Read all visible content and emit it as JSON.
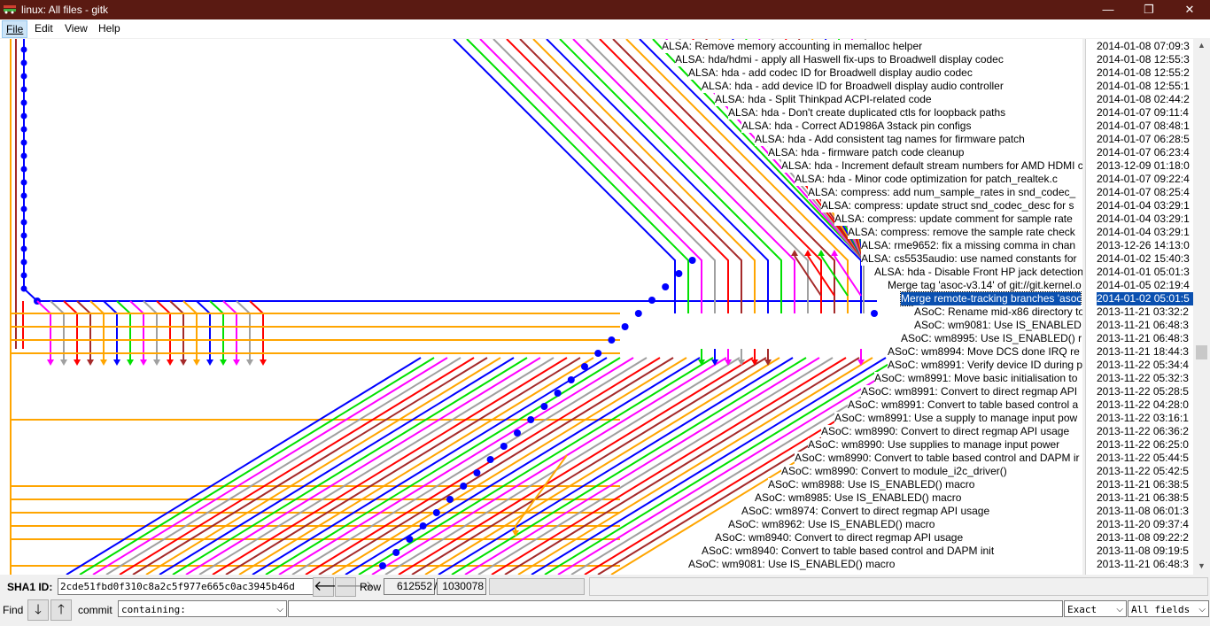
{
  "window": {
    "title": "linux: All files - gitk",
    "minimize_glyph": "—",
    "maximize_glyph": "❐",
    "close_glyph": "✕"
  },
  "menu": [
    {
      "label": "File"
    },
    {
      "label": "Edit"
    },
    {
      "label": "View"
    },
    {
      "label": "Help"
    }
  ],
  "commits": [
    {
      "subject": "ALSA: Remove memory accounting in memalloc helper",
      "date": "2014-01-08 07:09:3",
      "indent": 747
    },
    {
      "subject": "ALSA: hda/hdmi - apply all Haswell fix-ups to Broadwell display codec",
      "date": "2014-01-08 12:55:3",
      "indent": 762
    },
    {
      "subject": "ALSA: hda - add codec ID for Broadwell display audio codec",
      "date": "2014-01-08 12:55:2",
      "indent": 777
    },
    {
      "subject": "ALSA: hda - add device ID for Broadwell display audio controller",
      "date": "2014-01-08 12:55:1",
      "indent": 792
    },
    {
      "subject": "ALSA: hda - Split Thinkpad ACPI-related code",
      "date": "2014-01-08 02:44:2",
      "indent": 807
    },
    {
      "subject": "ALSA: hda - Don't create duplicated ctls for loopback paths",
      "date": "2014-01-07 09:11:4",
      "indent": 822
    },
    {
      "subject": "ALSA: hda - Correct AD1986A 3stack pin configs",
      "date": "2014-01-07 08:48:1",
      "indent": 837
    },
    {
      "subject": "ALSA: hda - Add consistent tag names for firmware patch",
      "date": "2014-01-07 06:28:5",
      "indent": 852
    },
    {
      "subject": "ALSA: hda - firmware patch code cleanup",
      "date": "2014-01-07 06:23:4",
      "indent": 867
    },
    {
      "subject": "ALSA: hda - Increment default stream numbers for AMD HDMI c",
      "date": "2013-12-09 01:18:0",
      "indent": 882
    },
    {
      "subject": "ALSA: hda - Minor code optimization for patch_realtek.c",
      "date": "2014-01-07 09:22:4",
      "indent": 897
    },
    {
      "subject": "ALSA: compress: add num_sample_rates in snd_codec_",
      "date": "2014-01-07 08:25:4",
      "indent": 912
    },
    {
      "subject": "ALSA: compress: update struct snd_codec_desc for s",
      "date": "2014-01-04 03:29:1",
      "indent": 927
    },
    {
      "subject": "ALSA: compress: update comment for sample rate",
      "date": "2014-01-04 03:29:1",
      "indent": 942
    },
    {
      "subject": "ALSA: compress: remove the sample rate check",
      "date": "2014-01-04 03:29:1",
      "indent": 957
    },
    {
      "subject": "ALSA: rme9652: fix a missing comma in chan",
      "date": "2013-12-26 14:13:0",
      "indent": 972
    },
    {
      "subject": "ALSA: cs5535audio: use named constants for",
      "date": "2014-01-02 15:40:3",
      "indent": 972
    },
    {
      "subject": "ALSA: hda - Disable Front HP jack detection",
      "date": "2014-01-01 05:01:3",
      "indent": 987
    },
    {
      "subject": "Merge tag 'asoc-v3.14' of git://git.kernel.o",
      "date": "2014-01-05 02:19:4",
      "indent": 1002
    },
    {
      "subject": "Merge remote-tracking branches 'asoc",
      "date": "2014-01-02 05:01:5",
      "indent": 1017,
      "selected": true
    },
    {
      "subject": "ASoC: Rename mid-x86 directory to",
      "date": "2013-11-21 03:32:2",
      "indent": 1032
    },
    {
      "subject": "ASoC: wm9081: Use IS_ENABLED",
      "date": "2013-11-21 06:48:3",
      "indent": 1032
    },
    {
      "subject": "ASoC: wm8995: Use IS_ENABLED() r",
      "date": "2013-11-21 06:48:3",
      "indent": 1017
    },
    {
      "subject": "ASoC: wm8994: Move DCS done IRQ re",
      "date": "2013-11-21 18:44:3",
      "indent": 1002
    },
    {
      "subject": "ASoC: wm8991: Verify device ID during p",
      "date": "2013-11-22 05:34:4",
      "indent": 1002
    },
    {
      "subject": "ASoC: wm8991: Move basic initialisation to",
      "date": "2013-11-22 05:32:3",
      "indent": 987
    },
    {
      "subject": "ASoC: wm8991: Convert to direct regmap API",
      "date": "2013-11-22 05:28:5",
      "indent": 972
    },
    {
      "subject": "ASoC: wm8991: Convert to table based control a",
      "date": "2013-11-22 04:28:0",
      "indent": 957
    },
    {
      "subject": "ASoC: wm8991: Use a supply to manage input pow",
      "date": "2013-11-22 03:16:1",
      "indent": 942
    },
    {
      "subject": "ASoC: wm8990: Convert to direct regmap API usage",
      "date": "2013-11-22 06:36:2",
      "indent": 927
    },
    {
      "subject": "ASoC: wm8990: Use supplies to manage input power",
      "date": "2013-11-22 06:25:0",
      "indent": 912
    },
    {
      "subject": "ASoC: wm8990: Convert to table based control and DAPM ir",
      "date": "2013-11-22 05:44:5",
      "indent": 897
    },
    {
      "subject": "ASoC: wm8990: Convert to module_i2c_driver()",
      "date": "2013-11-22 05:42:5",
      "indent": 882
    },
    {
      "subject": "ASoC: wm8988: Use IS_ENABLED() macro",
      "date": "2013-11-21 06:38:5",
      "indent": 867
    },
    {
      "subject": "ASoC: wm8985: Use IS_ENABLED() macro",
      "date": "2013-11-21 06:38:5",
      "indent": 852
    },
    {
      "subject": "ASoC: wm8974: Convert to direct regmap API usage",
      "date": "2013-11-08 06:01:3",
      "indent": 837
    },
    {
      "subject": "ASoC: wm8962: Use IS_ENABLED() macro",
      "date": "2013-11-20 09:37:4",
      "indent": 822
    },
    {
      "subject": "ASoC: wm8940: Convert to direct regmap API usage",
      "date": "2013-11-08 09:22:2",
      "indent": 807
    },
    {
      "subject": "ASoC: wm8940: Convert to table based control and DAPM init",
      "date": "2013-11-08 09:19:5",
      "indent": 792
    },
    {
      "subject": "ASoC: wm9081: Use IS_ENABLED() macro",
      "date": "2013-11-21 06:48:3",
      "indent": 777
    }
  ],
  "sha_bar": {
    "label": "SHA1 ID:",
    "value": "2cde51fbd0f310c8a2c5f977e665c0ac3945b46d",
    "back_glyph": "🡐",
    "forward_glyph": "🡒",
    "row_label": "Row",
    "row_current": "612552",
    "row_sep": "/",
    "row_total": "1030078"
  },
  "find_bar": {
    "label": "Find",
    "down_glyph": "🡓",
    "up_glyph": "🡑",
    "commit_label": "commit",
    "mode_value": "containing:",
    "search_value": "",
    "match_value": "Exact",
    "fields_value": "All fields",
    "chevron_glyph": "⌵"
  },
  "graph_colors": [
    "#0000ff",
    "#00e000",
    "#ff00ff",
    "#a0a0a0",
    "#ff0000",
    "#a52a2a",
    "#ffa500"
  ]
}
